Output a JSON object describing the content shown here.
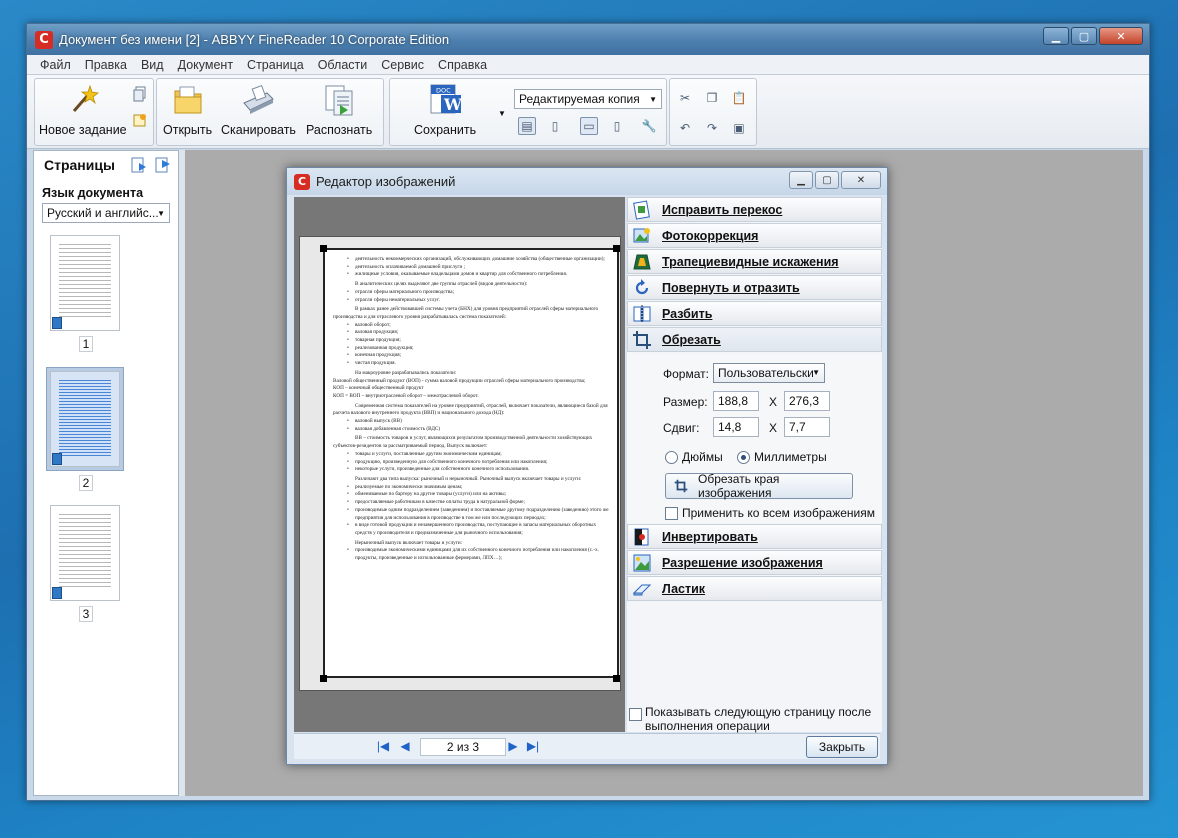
{
  "window": {
    "title": "Документ без имени [2] - ABBYY FineReader 10 Corporate Edition",
    "logo": "C"
  },
  "menu": [
    "Файл",
    "Правка",
    "Вид",
    "Документ",
    "Страница",
    "Области",
    "Сервис",
    "Справка"
  ],
  "toolbar": {
    "new_task": "Новое задание",
    "open": "Открыть",
    "scan": "Сканировать",
    "recognize": "Распознать",
    "save": "Сохранить",
    "save_badge": "DOC",
    "format": "Редактируемая копия"
  },
  "pages_panel": {
    "title": "Страницы",
    "lang_label": "Язык документа",
    "lang_value": "Русский и английс...",
    "pages": [
      "1",
      "2",
      "3"
    ]
  },
  "dialog": {
    "title": "Редактор изображений",
    "tools": [
      "Исправить перекос",
      "Фотокоррекция",
      "Трапециевидные искажения",
      "Повернуть и отразить",
      "Разбить",
      "Обрезать",
      "Инвертировать",
      "Разрешение изображения",
      "Ластик"
    ],
    "crop": {
      "format_label": "Формат:",
      "format_value": "Пользовательски",
      "size_label": "Размер:",
      "size_w": "188,8",
      "size_h": "276,3",
      "shift_label": "Сдвиг:",
      "shift_x": "14,8",
      "shift_y": "7,7",
      "x_sep": "X",
      "unit_inches": "Дюймы",
      "unit_mm": "Миллиметры",
      "crop_button": "Обрезать края изображения",
      "apply_all": "Применить ко всем изображениям"
    },
    "show_next": "Показывать следующую страницу после выполнения операции",
    "page_indicator": "2 из 3",
    "close_button": "Закрыть"
  },
  "document": {
    "lines": [
      {
        "t": "b",
        "s": "деятельность некоммерческих организаций, обслуживающих домашние хозяйства (общественные организации);"
      },
      {
        "t": "b",
        "s": "деятельность оплачиваемой домашней прислуги ;"
      },
      {
        "t": "b",
        "s": "жилищные условия, оказываемые владельцами домов и квартир для собственного потребления."
      },
      {
        "t": "i",
        "s": "В аналитических целях выделяют две группы отраслей (видов деятельности):"
      },
      {
        "t": "b",
        "s": "отрасли сферы материального производства;"
      },
      {
        "t": "b",
        "s": "отрасли сферы нематериальных услуг."
      },
      {
        "t": "i",
        "s": "В рамках ранее действовавшей системы учета (БНХ) для уровня предприятий отраслей сферы материального производства и для отраслевого уровня разрабатывалась система показателей:"
      },
      {
        "t": "b",
        "s": "валовой оборот;"
      },
      {
        "t": "b",
        "s": "валовая продукция;"
      },
      {
        "t": "b",
        "s": "товарная продукция;"
      },
      {
        "t": "b",
        "s": "реализованная продукция;"
      },
      {
        "t": "b",
        "s": "конечная продукция;"
      },
      {
        "t": "b",
        "s": "чистая продукция."
      },
      {
        "t": "i",
        "s": "На макроуровне разрабатывались показатели:"
      },
      {
        "t": "p",
        "s": "Валовой общественный продукт (ВОП) - сумма валовой продукции отраслей сферы материального производства;"
      },
      {
        "t": "p",
        "s": "КОП – конечный общественный продукт"
      },
      {
        "t": "p",
        "s": "КОП = ВОП – внутриотраслевой оборот – межотраслевой оборот."
      },
      {
        "t": "i",
        "s": "Современная система показателей на уровне предприятий, отраслей, включает показатели, являющиеся базой для расчета валового внутреннего продукта (ВВП) и национального дохода (НД):"
      },
      {
        "t": "b",
        "s": "валовой выпуск (ВВ)"
      },
      {
        "t": "b",
        "s": "валовая добавленная стоимость (ВДС)"
      },
      {
        "t": "i",
        "s": "ВВ – стоимость товаров и услуг, являющихся результатом производственной деятельности хозяйствующих субъектов-резидентов за рассматриваемый период. Выпуск включает:"
      },
      {
        "t": "b",
        "s": "товары и услуги, поставленные другим экономическим единицам;"
      },
      {
        "t": "b",
        "s": "продукцию, произведенную для собственного конечного потребления или накопления;"
      },
      {
        "t": "b",
        "s": "некоторые услуги, произведенные для собственного конечного использования."
      },
      {
        "t": "i",
        "s": "Различают два типа выпуска: рыночный и нерыночный. Рыночный выпуск включает товары и услуги:"
      },
      {
        "t": "b",
        "s": "реализуемые по экономически значимым ценам;"
      },
      {
        "t": "b",
        "s": "обмениваемые по бартеру на другие товары (услуги) или на активы;"
      },
      {
        "t": "b",
        "s": "предоставляемые работникам в качестве оплаты труда в натуральной форме;"
      },
      {
        "t": "b",
        "s": "производимые одним подразделением (заведением) и поставляемые другому подразделению (заведению) этого же предприятия для использования в производстве в том же или последующих периодах;"
      },
      {
        "t": "b",
        "s": "в виде готовой продукции и незавершенного производства, поступающие в запасы материальных оборотных средств у производителя и предназначенные для рыночного использования;"
      },
      {
        "t": "i",
        "s": "Нерыночный выпуск включает товары и услуги:"
      },
      {
        "t": "b",
        "s": "производимые экономическими единицами для их собственного конечного потребления или накопления (с.-х. продукты, произведенные и использованные фермерами, ЛПХ…);"
      }
    ]
  }
}
